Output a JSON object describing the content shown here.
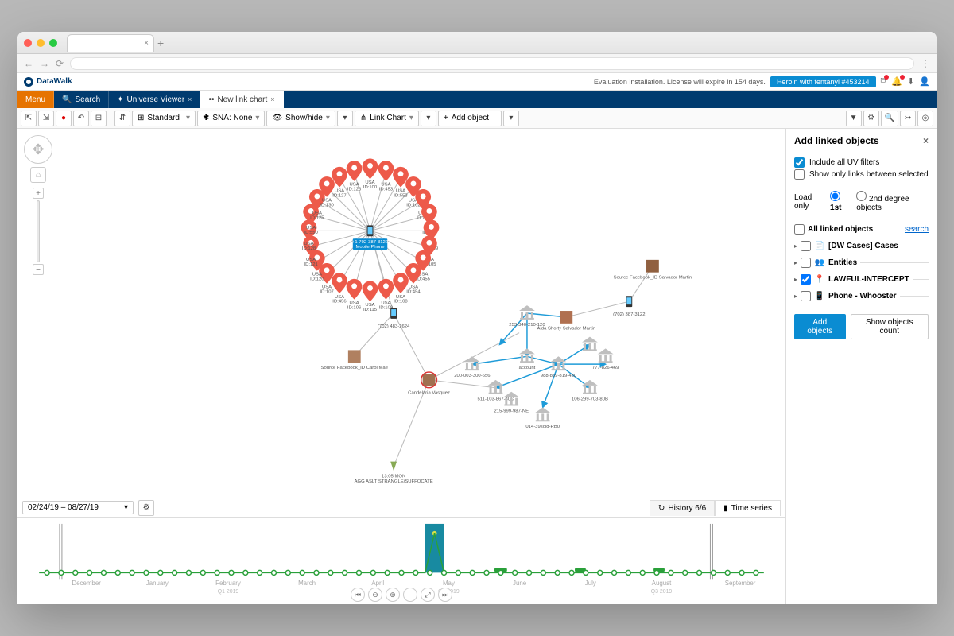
{
  "brand": "DataWalk",
  "license_text": "Evaluation installation. License will expire in 154 days.",
  "context_badge": "Heroin with fentanyl #453214",
  "menu": {
    "menu_label": "Menu",
    "search_label": "Search",
    "universe_label": "Universe Viewer",
    "linkchart_label": "New link chart"
  },
  "toolbar": {
    "layout_label": "Standard",
    "sna_label": "SNA: None",
    "showhide_label": "Show/hide",
    "view_label": "Link Chart",
    "add_label": "Add object",
    "hierarchical_icon": "⇵"
  },
  "timeline": {
    "date_range": "02/24/19 – 08/27/19",
    "history_label": "History 6/6",
    "timeseries_label": "Time series",
    "months": [
      "December",
      "January",
      "February",
      "March",
      "April",
      "May",
      "June",
      "July",
      "August",
      "September"
    ],
    "quarters": [
      "Q1  2019",
      "Q2  2019",
      "Q3  2019"
    ]
  },
  "panel": {
    "title": "Add linked objects",
    "include_uv": "Include all UV filters",
    "show_only": "Show only links between selected",
    "load_only": "Load only",
    "first": "1st",
    "second": "2nd   degree objects",
    "all_linked": "All linked objects",
    "search": "search",
    "cats": {
      "cases": "[DW Cases] Cases",
      "entities": "Entities",
      "lawful": "LAWFUL-INTERCEPT",
      "phone": "Phone - Whooster"
    },
    "add_btn": "Add objects",
    "count_btn": "Show objects count"
  },
  "graph": {
    "center_phone": "+1 702-387-3122",
    "center_label": "Mobile Phone",
    "ring_label_top": "USA",
    "ring_label_bottom": "ID:",
    "phone2": "(702) 483-2624",
    "phone3": "(702) 387-3122",
    "person1": "Source Facebook_ID Carol Mae",
    "person2": "Candelaria Vasquez",
    "person3": "Source Facebook_ID Salvador Martin",
    "person4": "Aida Shorty Salvador Martin",
    "case_node": "AGG ASLT STRANGLE/SUFFOCATE",
    "case_date": "13:05 MON",
    "bank_ids": [
      "253-340-210-120",
      "200-003-300-656",
      "511-103-867-40C",
      "215-999-987-NE",
      "014-39sold-RB0",
      "106-299-703-80B",
      "777-826-469",
      "988-859-819-430",
      "account"
    ]
  }
}
